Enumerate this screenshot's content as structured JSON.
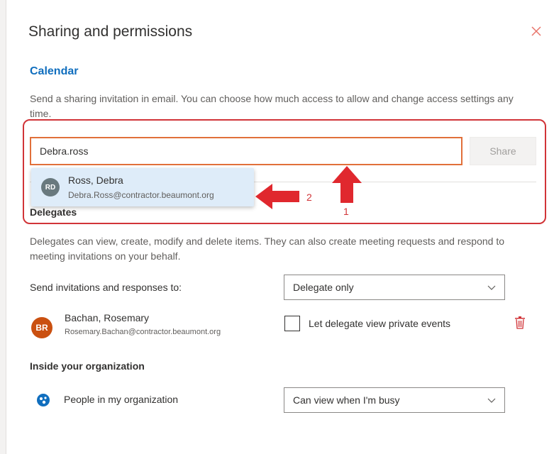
{
  "dialog": {
    "title": "Sharing and permissions"
  },
  "calendar": {
    "section_title": "Calendar",
    "description": "Send a sharing invitation in email. You can choose how much access to allow and change access settings any time.",
    "input_value": "Debra.ross",
    "share_label": "Share",
    "suggestion": {
      "initials": "RD",
      "name": "Ross, Debra",
      "email": "Debra.Ross@contractor.beaumont.org"
    }
  },
  "annotations": {
    "label_1": "1",
    "label_2": "2"
  },
  "delegates": {
    "header": "Delegates",
    "description": "Delegates can view, create, modify and delete items. They can also create meeting requests and respond to meeting invitations on your behalf.",
    "send_label": "Send invitations and responses to:",
    "send_value": "Delegate only",
    "person": {
      "initials": "BR",
      "name": "Bachan, Rosemary",
      "email": "Rosemary.Bachan@contractor.beaumont.org"
    },
    "checkbox_label": "Let delegate view private events"
  },
  "organization": {
    "header": "Inside your organization",
    "people_label": "People in my organization",
    "permission_value": "Can view when I'm busy"
  },
  "colors": {
    "accent": "#106ebe",
    "highlight_red": "#d13438",
    "avatar_br": "#ca5010",
    "suggestion_bg": "#deecf9"
  },
  "icons": [
    "close-icon",
    "chevron-down-icon",
    "trash-icon",
    "org-people-icon",
    "arrow-up-icon",
    "arrow-left-icon"
  ]
}
